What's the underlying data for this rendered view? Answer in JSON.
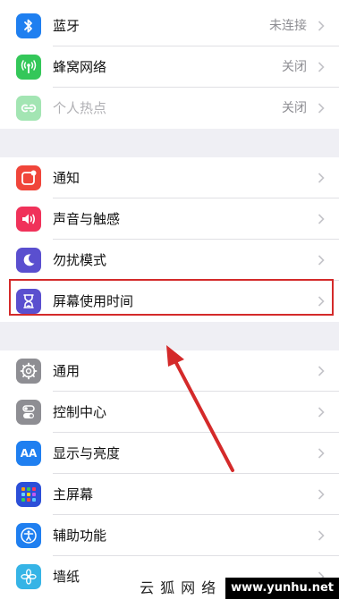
{
  "group1": {
    "items": [
      {
        "label": "蓝牙",
        "value": "未连接",
        "icon": "bluetooth-icon",
        "color": "#1f7ff0"
      },
      {
        "label": "蜂窝网络",
        "value": "关闭",
        "icon": "cellular-antenna-icon",
        "color": "#34c759"
      },
      {
        "label": "个人热点",
        "value": "关闭",
        "icon": "personal-hotspot-icon",
        "color": "#34c759",
        "disabled": true
      }
    ]
  },
  "group2": {
    "items": [
      {
        "label": "通知",
        "icon": "notifications-icon",
        "color": "#f0453a"
      },
      {
        "label": "声音与触感",
        "icon": "speaker-icon",
        "color": "#f0325a"
      },
      {
        "label": "勿扰模式",
        "icon": "moon-icon",
        "color": "#5a4fcf"
      },
      {
        "label": "屏幕使用时间",
        "icon": "hourglass-icon",
        "color": "#5a4fcf",
        "highlighted": true
      }
    ]
  },
  "group3": {
    "items": [
      {
        "label": "通用",
        "icon": "gear-icon",
        "color": "#8e8e93"
      },
      {
        "label": "控制中心",
        "icon": "toggles-icon",
        "color": "#8e8e93"
      },
      {
        "label": "显示与亮度",
        "icon": "text-size-icon",
        "color": "#1f7ff0"
      },
      {
        "label": "主屏幕",
        "icon": "app-grid-icon",
        "color": "#2c4fd8"
      },
      {
        "label": "辅助功能",
        "icon": "accessibility-icon",
        "color": "#1f7ff0"
      },
      {
        "label": "墙纸",
        "icon": "flower-icon",
        "color": "#36b4e6"
      }
    ]
  },
  "icon_text": {
    "text_size": "AA"
  },
  "annotation": {
    "box_color": "#d42a2a",
    "arrow_color": "#d42a2a"
  },
  "watermark": {
    "text_cn": "云狐网络",
    "url": "www.yunhu.net"
  }
}
